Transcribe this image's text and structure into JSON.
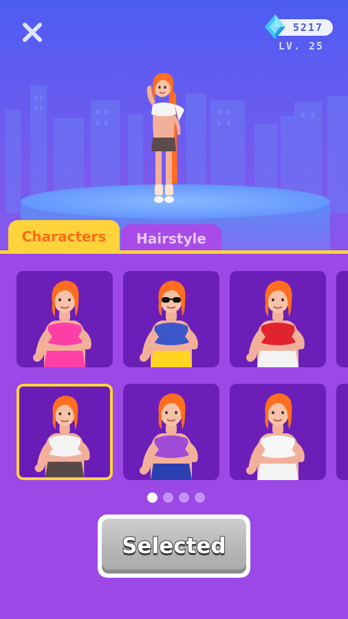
{
  "header": {
    "gems": "5217",
    "level": "LV. 25",
    "close_icon": "close-icon",
    "gem_icon": "diamond-icon"
  },
  "tabs": [
    {
      "label": "Characters",
      "active": true
    },
    {
      "label": "Hairstyle",
      "active": false
    }
  ],
  "outfits": [
    {
      "name": "pink-dress",
      "top": "#ff3fa6",
      "bottom": "#ff3fa6",
      "selected": false
    },
    {
      "name": "blue-crop-yellow-pants",
      "top": "#3b57c9",
      "bottom": "#ffd51f",
      "selected": false,
      "accessory": "sunglasses"
    },
    {
      "name": "red-bra-white-skirt",
      "top": "#e0232d",
      "bottom": "#f3f3f3",
      "selected": false
    },
    {
      "name": "white-crop-shorts",
      "top": "#f4f4f4",
      "bottom": "#5a4848",
      "selected": true
    },
    {
      "name": "purple-tank-galaxy-skirt",
      "top": "#a04ad8",
      "bottom": "#2a3fb0",
      "selected": false
    },
    {
      "name": "white-lace-outfit",
      "top": "#f7f7f7",
      "bottom": "#f3f3f3",
      "selected": false
    }
  ],
  "pagination": {
    "pages": 4,
    "current": 1
  },
  "action_button": {
    "label": "Selected"
  },
  "colors": {
    "accent": "#ffd43b",
    "tab_active_text": "#ff6a1a",
    "panel": "#9b48e6",
    "card": "#6b1fb8"
  }
}
